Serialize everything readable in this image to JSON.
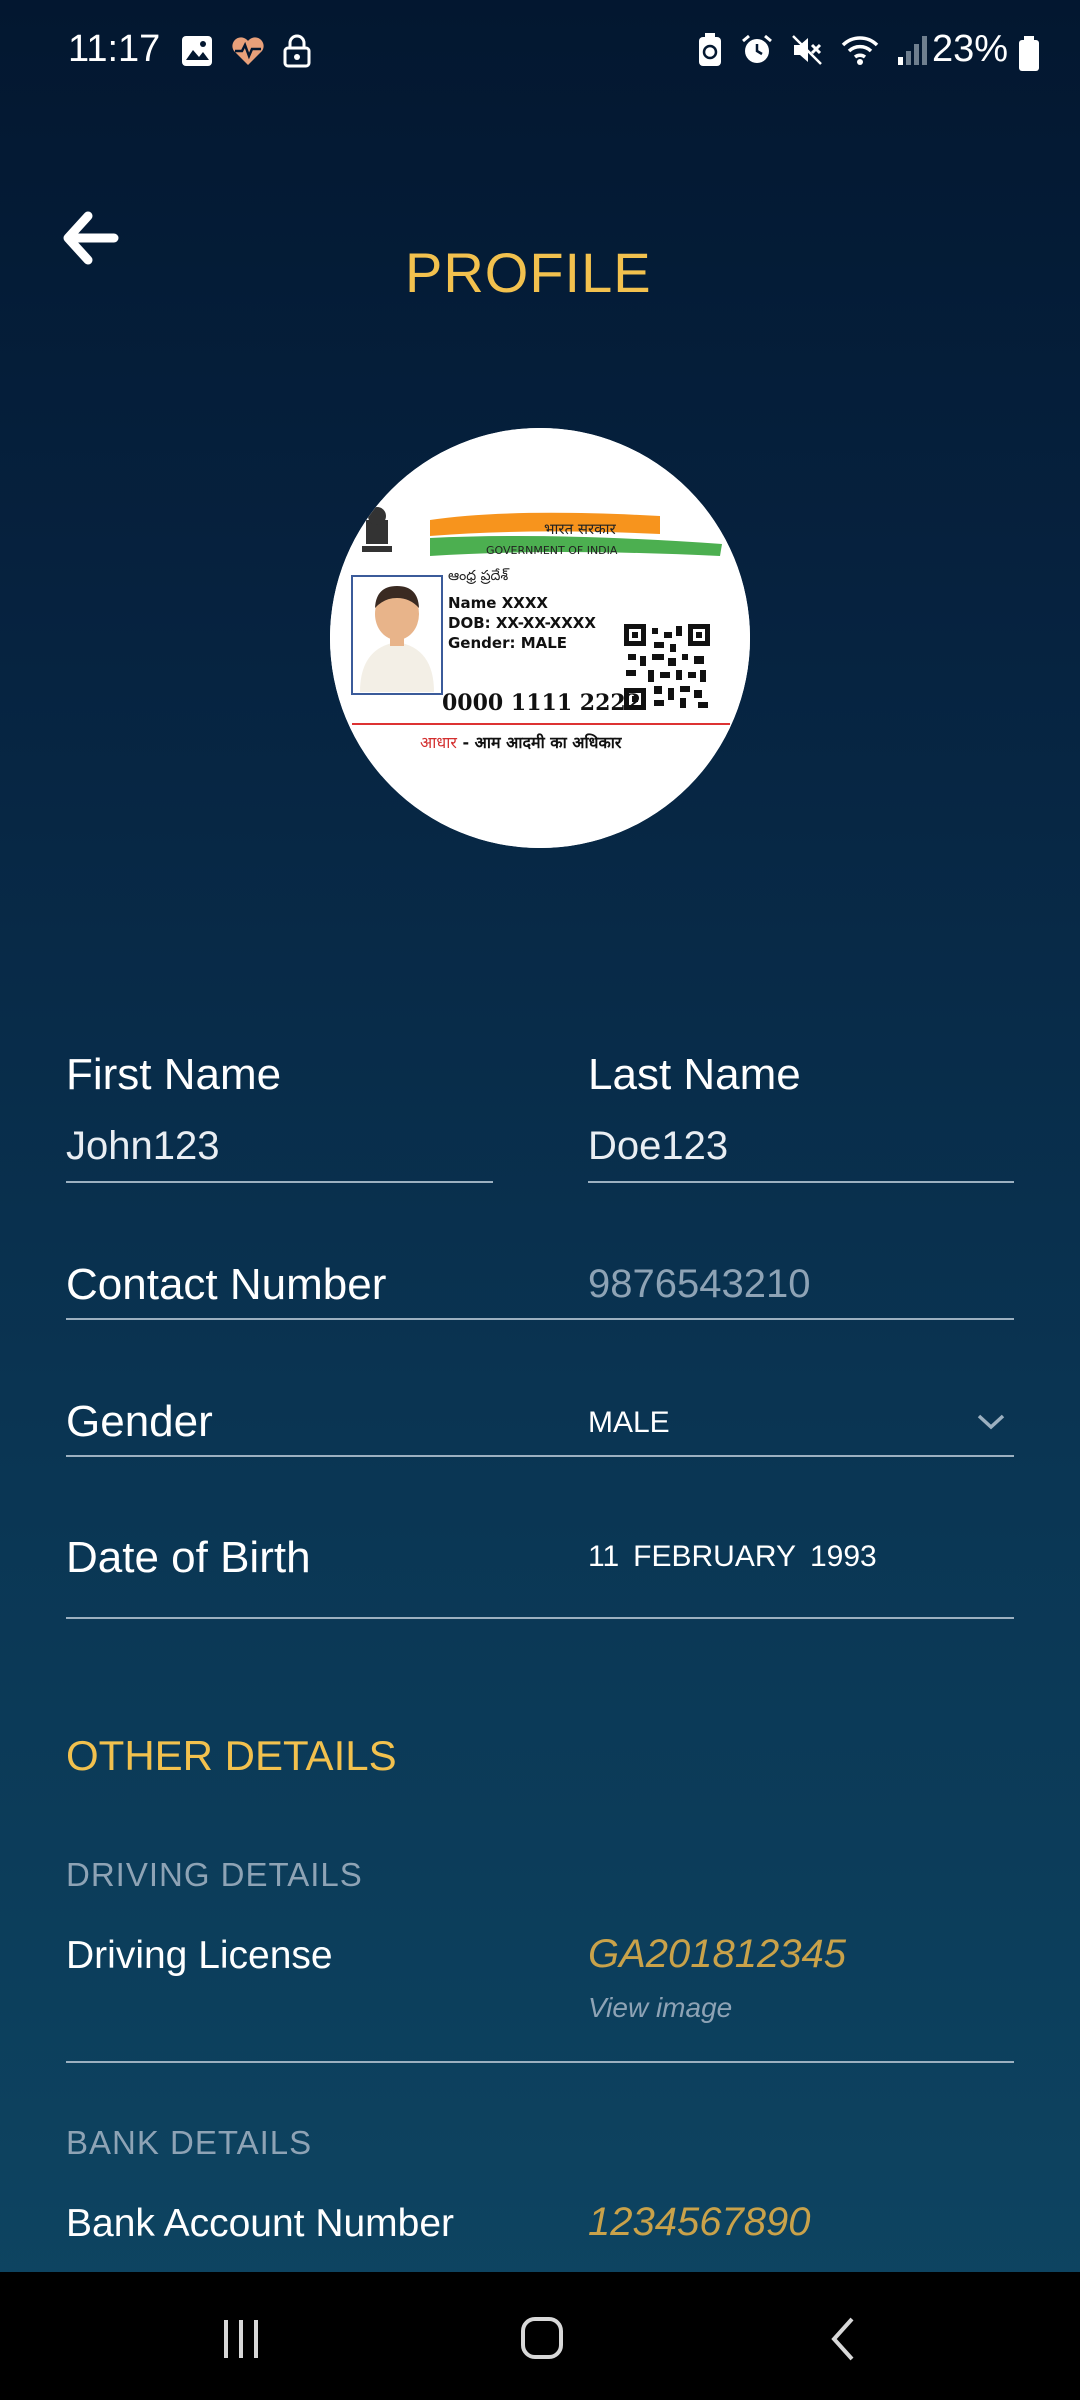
{
  "status_bar": {
    "time": "11:17",
    "battery_text": "23%",
    "left_icons": [
      "image-icon",
      "health-icon",
      "lock-icon"
    ],
    "right_icons": [
      "battery-saver-icon",
      "alarm-icon",
      "mute-icon",
      "wifi-icon",
      "signal-icon"
    ]
  },
  "header": {
    "title": "PROFILE",
    "back_icon": "arrow-left-icon"
  },
  "card": {
    "govt_hindi": "भारत सरकार",
    "govt_english": "GOVERNMENT OF INDIA",
    "state": "ఆంధ్ర ప్రదేశ్",
    "name": "Name XXXX",
    "dob": "DOB: XX-XX-XXXX",
    "gender": "Gender: MALE",
    "number": "0000 1111 2222",
    "footer_red": "आधार",
    "footer_black": " - आम आदमी का अधिकार"
  },
  "form": {
    "first_name_label": "First Name",
    "first_name_value": "John123",
    "last_name_label": "Last Name",
    "last_name_value": "Doe123",
    "contact_label": "Contact Number",
    "contact_value": "9876543210",
    "gender_label": "Gender",
    "gender_value": "MALE",
    "dob_label": "Date of Birth",
    "dob_day": "11",
    "dob_month": "FEBRUARY",
    "dob_year": "1993"
  },
  "other": {
    "section_title": "OTHER DETAILS",
    "driving_header": "DRIVING DETAILS",
    "driving_label": "Driving License",
    "driving_value": "GA201812345",
    "view_image": "View image",
    "bank_header": "BANK DETAILS",
    "bank_label": "Bank Account Number",
    "bank_value": "1234567890"
  },
  "colors": {
    "accent": "#f2c14e",
    "value_italic": "#c9a24a",
    "muted": "#8ea3b5"
  }
}
